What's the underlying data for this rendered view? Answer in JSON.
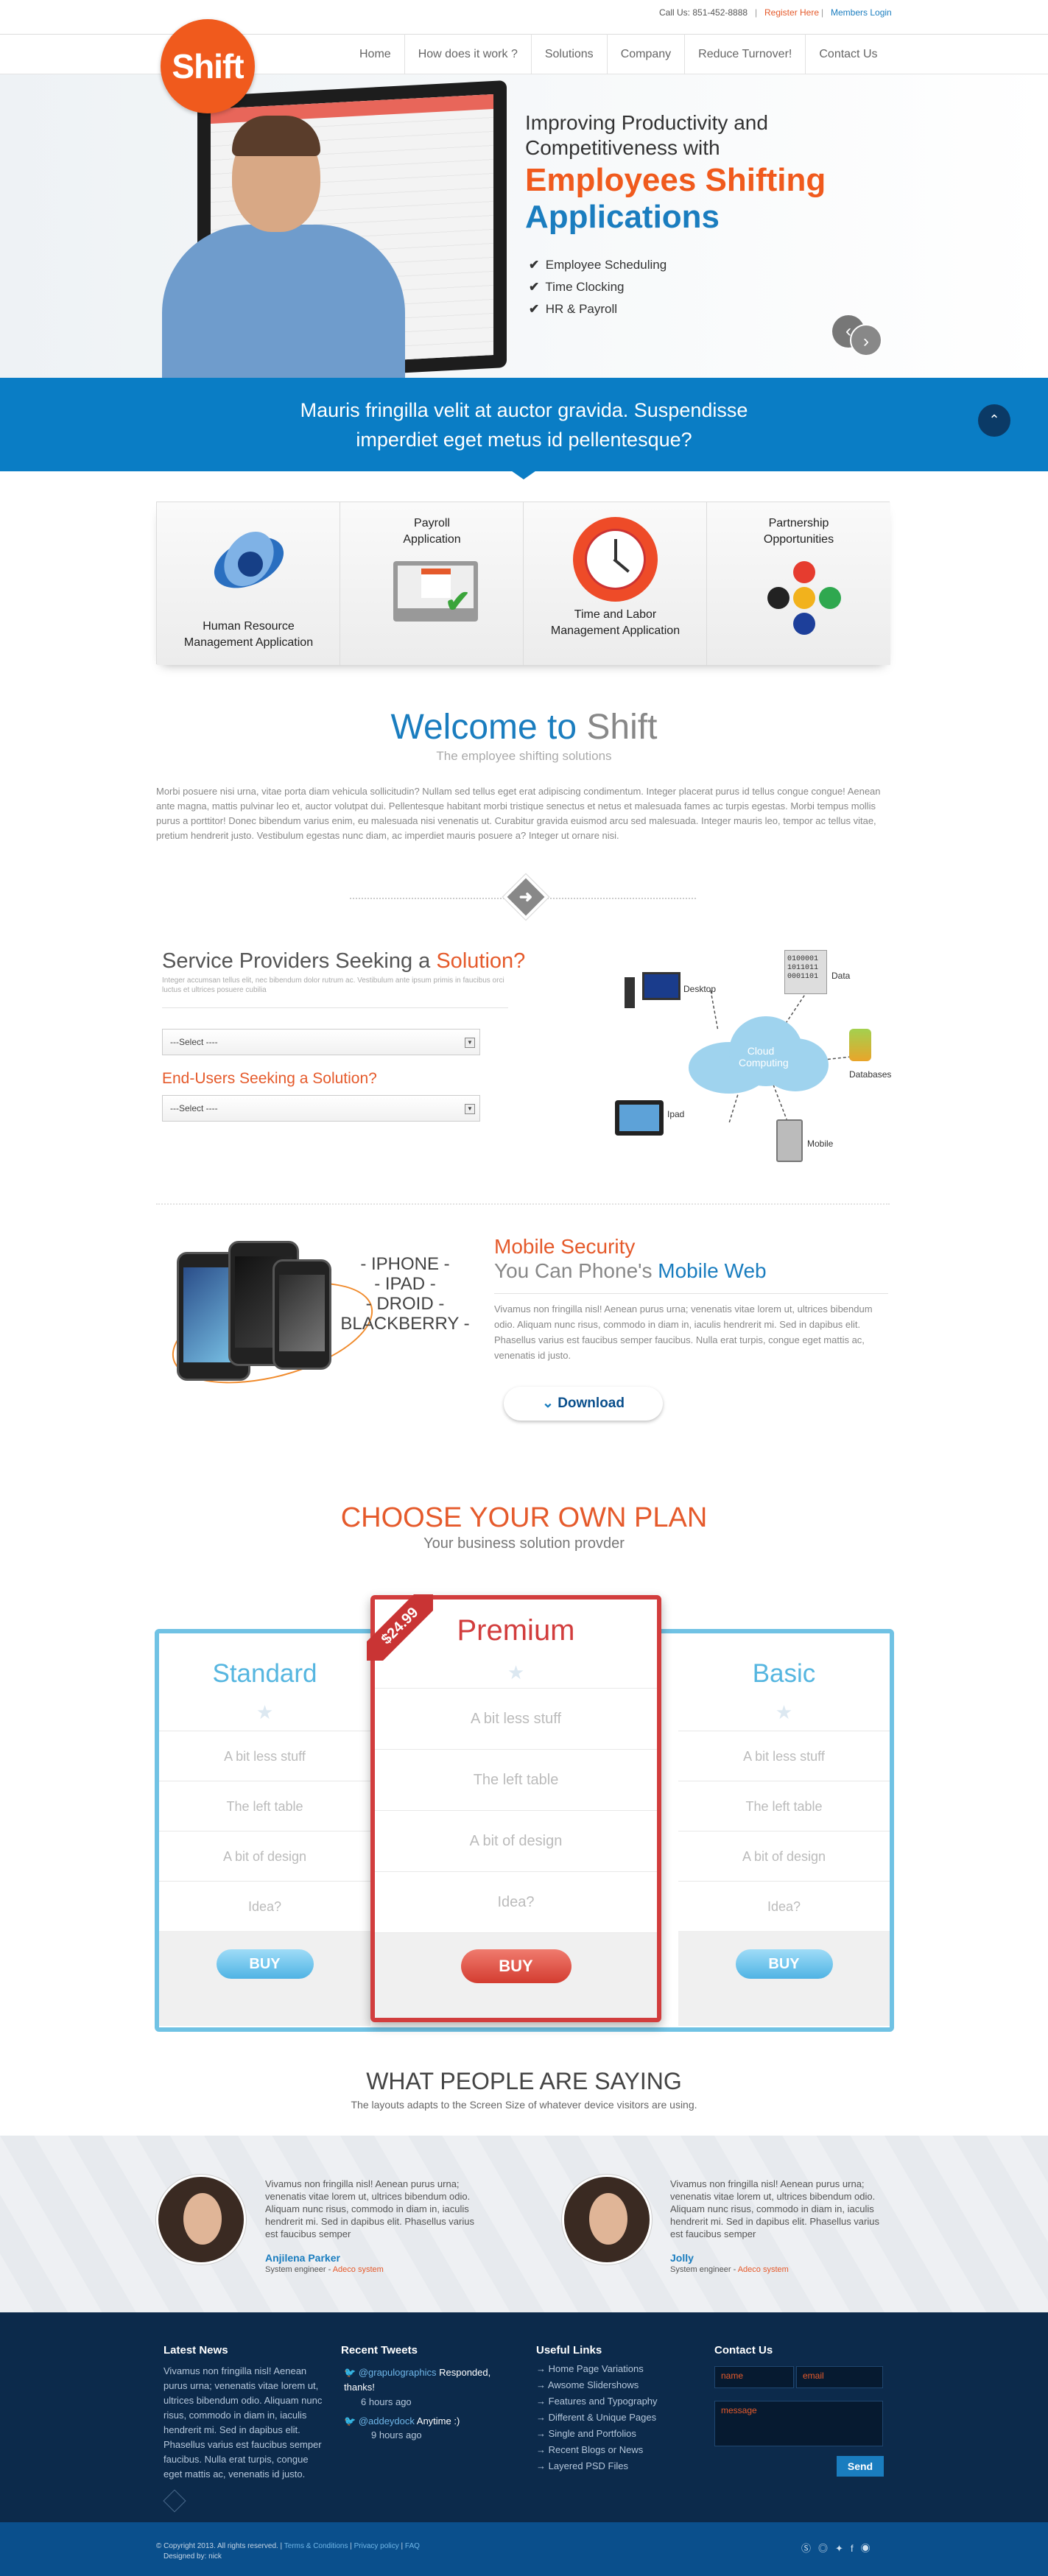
{
  "topbar": {
    "call": "Call Us: 851-452-8888",
    "sep": "|",
    "register": "Register Here",
    "members": "Members Login"
  },
  "logo": {
    "text": "Shift"
  },
  "nav": [
    "Home",
    "How does it work ?",
    "Solutions",
    "Company",
    "Reduce Turnover!",
    "Contact Us"
  ],
  "hero": {
    "line1": "Improving Productivity and",
    "line2": "Competitiveness with",
    "line3": "Employees Shifting",
    "line4": "Applications",
    "bullets": [
      "Employee Scheduling",
      "Time Clocking",
      "HR & Payroll"
    ],
    "check": "✔"
  },
  "band": {
    "line1": "Mauris fringilla velit at auctor gravida. Suspendisse",
    "line2": "imperdiet eget metus id pellentesque?"
  },
  "features": [
    {
      "line1": "Human Resource",
      "line2": "Management Application"
    },
    {
      "line1": "Payroll",
      "line2": "Application"
    },
    {
      "line1": "Time and Labor",
      "line2": "Management Application"
    },
    {
      "line1": "Partnership",
      "line2": "Opportunities"
    }
  ],
  "welcome": {
    "title_a": "Welcome to ",
    "title_b": "Shift",
    "subtitle": "The employee shifting solutions",
    "body": "Morbi posuere nisi urna, vitae porta diam vehicula sollicitudin? Nullam sed tellus eget erat adipiscing condimentum. Integer placerat purus id tellus congue congue! Aenean ante magna, mattis pulvinar leo et, auctor volutpat dui. Pellentesque habitant morbi tristique senectus et netus et malesuada fames ac turpis egestas. Morbi tempus mollis purus a porttitor! Donec bibendum varius enim, eu malesuada nisi venenatis ut. Curabitur gravida euismod arcu sed malesuada. Integer mauris leo, tempor ac tellus vitae, pretium hendrerit justo. Vestibulum egestas nunc diam, ac imperdiet mauris posuere a? Integer ut ornare nisi.",
    "divider_icon": "arrow-right-icon"
  },
  "service": {
    "title_a": "Service Providers Seeking a ",
    "title_b": "Solution?",
    "small": "Integer accumsan tellus elit, nec bibendum dolor rutrum ac. Vestibulum ante ipsum primis in faucibus orci luctus et ultrices posuere cubilia",
    "select1": "---Select ----",
    "end_title": "End-Users Seeking a Solution?",
    "select2": "---Select ----"
  },
  "diagram": {
    "center_a": "Cloud",
    "center_b": "Computing",
    "desktop": "Desktop",
    "data": "Data",
    "databases": "Databases",
    "ipad": "Ipad",
    "mobile": "Mobile",
    "bits": "0100001\n1011011\n0001101"
  },
  "mobile": {
    "devices": [
      "- IPHONE -",
      "- IPAD -",
      "- DROID -",
      "BLACKBERRY -"
    ],
    "title1": "Mobile Security",
    "title2_a": "You Can Phone's ",
    "title2_b": "Mobile Web",
    "body": "Vivamus non fringilla nisl! Aenean purus urna; venenatis vitae lorem ut, ultrices bibendum odio. Aliquam nunc risus, commodo in diam in, iaculis hendrerit mi. Sed in dapibus elit. Phasellus varius est faucibus semper faucibus. Nulla erat turpis, congue eget mattis ac, venenatis id justo.",
    "download": "Download",
    "download_icon": "chevron-down-icon"
  },
  "plans": {
    "title": "CHOOSE YOUR OWN PLAN",
    "subtitle": "Your business solution provder",
    "standard": {
      "name": "Standard",
      "rows": [
        "A bit less stuff",
        "The left table",
        "A bit of design",
        "Idea?"
      ],
      "buy": "BUY"
    },
    "premium": {
      "name": "Premium",
      "price": "$24.99",
      "rows": [
        "A bit less stuff",
        "The left table",
        "A bit of design",
        "Idea?"
      ],
      "buy": "BUY"
    },
    "basic": {
      "name": "Basic",
      "rows": [
        "A bit less stuff",
        "The left table",
        "A bit of design",
        "Idea?"
      ],
      "buy": "BUY"
    },
    "star": "★"
  },
  "testimonials": {
    "title": "WHAT PEOPLE ARE SAYING",
    "subtitle": "The layouts adapts to the Screen Size of whatever device visitors are using.",
    "items": [
      {
        "body": "Vivamus non fringilla nisl! Aenean purus urna; venenatis vitae lorem ut, ultrices bibendum odio. Aliquam nunc risus, commodo in diam in, iaculis hendrerit mi. Sed in dapibus elit. Phasellus varius est faucibus semper",
        "name": "Anjilena Parker",
        "role": "System engineer - ",
        "company": "Adeco system"
      },
      {
        "body": "Vivamus non fringilla nisl! Aenean purus urna; venenatis vitae lorem ut, ultrices bibendum odio. Aliquam nunc risus, commodo in diam in, iaculis hendrerit mi. Sed in dapibus elit. Phasellus varius est faucibus semper",
        "name": "Jolly",
        "role": "System engineer - ",
        "company": "Adeco system"
      }
    ]
  },
  "footer": {
    "news_title": "Latest News",
    "news_body": "Vivamus non fringilla nisl! Aenean purus urna; venenatis vitae lorem ut, ultrices bibendum odio. Aliquam nunc risus, commodo in diam in, iaculis hendrerit mi. Sed in dapibus elit. Phasellus varius est faucibus semper faucibus. Nulla erat turpis, congue eget mattis ac, venenatis id justo.",
    "tweets_title": "Recent Tweets",
    "tweets": [
      {
        "handle": "@grapulographics",
        "text": " Responded, thanks!",
        "time": "6 hours ago"
      },
      {
        "handle": "@addeydock",
        "text": " Anytime :)",
        "time": "9 hours ago"
      }
    ],
    "links_title": "Useful Links",
    "links": [
      "Home Page Variations",
      "Awsome Slidershows",
      "Features and Typography",
      "Different & Unique Pages",
      "Single and Portfolios",
      "Recent Blogs or News",
      "Layered PSD Files"
    ],
    "contact_title": "Contact Us",
    "name_ph": "name",
    "email_ph": "email",
    "message_ph": "message",
    "send": "Send",
    "copyright": "© Copyright 2013. All rights reserved.",
    "terms": "Terms & Conditions",
    "privacy": "Privacy policy",
    "faq": "FAQ",
    "designed": "Designed by: nick",
    "social": [
      "skype-icon",
      "dribbble-icon",
      "twitter-icon",
      "facebook-icon",
      "rss-icon"
    ]
  }
}
